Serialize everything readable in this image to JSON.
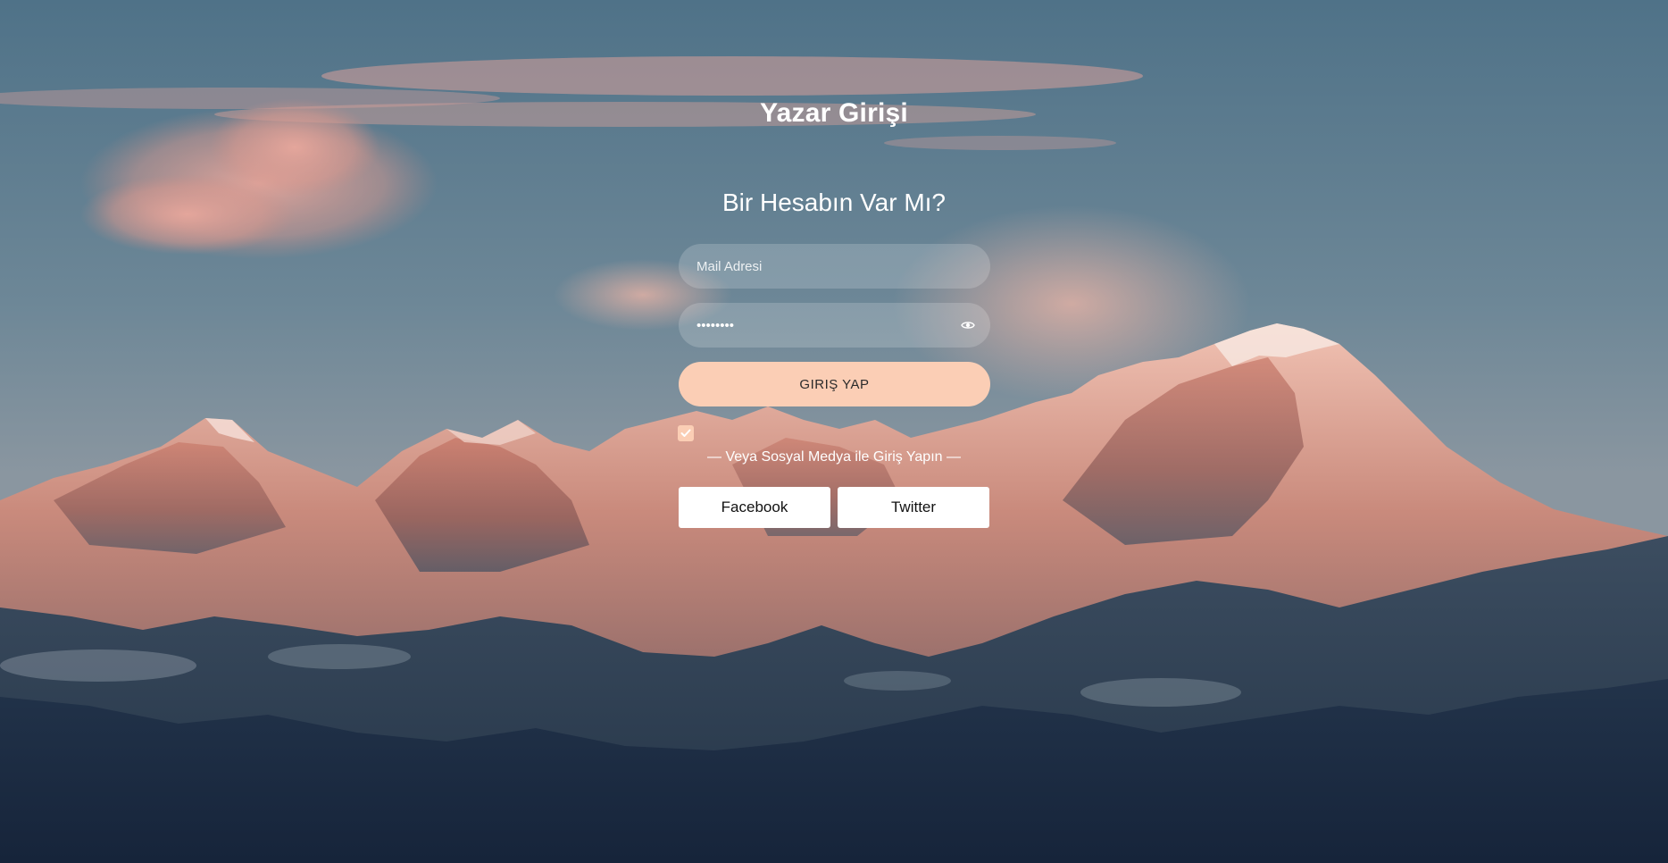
{
  "page": {
    "title": "Yazar Girişi",
    "subtitle": "Bir Hesabın Var Mı?"
  },
  "form": {
    "email": {
      "placeholder": "Mail Adresi",
      "value": ""
    },
    "password": {
      "value": "••••••••",
      "toggle_icon": "eye-icon"
    },
    "submit_label": "GIRIŞ YAP",
    "remember_checked": true
  },
  "social": {
    "divider_text": "— Veya Sosyal Medya ile Giriş Yapın —",
    "facebook_label": "Facebook",
    "twitter_label": "Twitter"
  },
  "colors": {
    "accent": "#fbceb5",
    "field_bg": "rgba(255,255,255,0.18)",
    "text_light": "#ffffff"
  }
}
